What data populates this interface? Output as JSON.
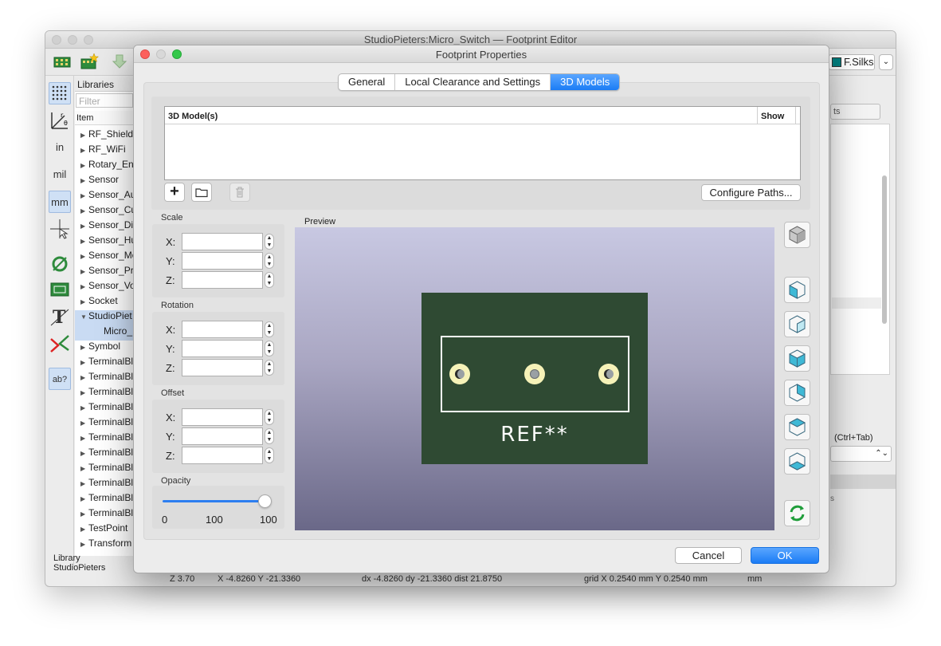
{
  "main_window": {
    "title": "StudioPieters:Micro_Switch — Footprint Editor",
    "layer_select": "F.Silks"
  },
  "left_toolbar": {
    "unit_in": "in",
    "unit_mil": "mil",
    "unit_mm": "mm",
    "ab_label": "ab?"
  },
  "libraries": {
    "header": "Libraries",
    "filter_placeholder": "Filter",
    "column_header": "Item",
    "items": [
      {
        "label": "RF_Shieldi",
        "expanded": false,
        "selected": false,
        "child": false
      },
      {
        "label": "RF_WiFi",
        "expanded": false,
        "selected": false,
        "child": false
      },
      {
        "label": "Rotary_Enc",
        "expanded": false,
        "selected": false,
        "child": false
      },
      {
        "label": "Sensor",
        "expanded": false,
        "selected": false,
        "child": false
      },
      {
        "label": "Sensor_Au",
        "expanded": false,
        "selected": false,
        "child": false
      },
      {
        "label": "Sensor_Cu",
        "expanded": false,
        "selected": false,
        "child": false
      },
      {
        "label": "Sensor_Di",
        "expanded": false,
        "selected": false,
        "child": false
      },
      {
        "label": "Sensor_Hu",
        "expanded": false,
        "selected": false,
        "child": false
      },
      {
        "label": "Sensor_Mo",
        "expanded": false,
        "selected": false,
        "child": false
      },
      {
        "label": "Sensor_Pr",
        "expanded": false,
        "selected": false,
        "child": false
      },
      {
        "label": "Sensor_Vo",
        "expanded": false,
        "selected": false,
        "child": false
      },
      {
        "label": "Socket",
        "expanded": false,
        "selected": false,
        "child": false
      },
      {
        "label": "StudioPiet",
        "expanded": true,
        "selected": true,
        "child": false
      },
      {
        "label": "Micro_",
        "expanded": false,
        "selected": true,
        "child": true
      },
      {
        "label": "Symbol",
        "expanded": false,
        "selected": false,
        "child": false
      },
      {
        "label": "TerminalBl",
        "expanded": false,
        "selected": false,
        "child": false
      },
      {
        "label": "TerminalBl",
        "expanded": false,
        "selected": false,
        "child": false
      },
      {
        "label": "TerminalBl",
        "expanded": false,
        "selected": false,
        "child": false
      },
      {
        "label": "TerminalBl",
        "expanded": false,
        "selected": false,
        "child": false
      },
      {
        "label": "TerminalBl",
        "expanded": false,
        "selected": false,
        "child": false
      },
      {
        "label": "TerminalBl",
        "expanded": false,
        "selected": false,
        "child": false
      },
      {
        "label": "TerminalBl",
        "expanded": false,
        "selected": false,
        "child": false
      },
      {
        "label": "TerminalBl",
        "expanded": false,
        "selected": false,
        "child": false
      },
      {
        "label": "TerminalBl",
        "expanded": false,
        "selected": false,
        "child": false
      },
      {
        "label": "TerminalBl",
        "expanded": false,
        "selected": false,
        "child": false
      },
      {
        "label": "TerminalBl",
        "expanded": false,
        "selected": false,
        "child": false
      },
      {
        "label": "TestPoint",
        "expanded": false,
        "selected": false,
        "child": false
      },
      {
        "label": "Transform",
        "expanded": false,
        "selected": false,
        "child": false
      }
    ],
    "footer_label": "Library",
    "footer_value": "StudioPieters"
  },
  "status_bar": {
    "zoom": "Z 3.70",
    "xy": "X -4.8260  Y -21.3360",
    "delta": "dx -4.8260  dy -21.3360  dist 21.8750",
    "grid": "grid X 0.2540 mm  Y 0.2540 mm",
    "units": "mm"
  },
  "right_panel": {
    "tab_fragment": "ts",
    "shortcut": "(Ctrl+Tab)",
    "fragment_s": "s"
  },
  "dialog": {
    "title": "Footprint Properties",
    "tabs": [
      {
        "label": "General",
        "active": false
      },
      {
        "label": "Local Clearance and Settings",
        "active": false
      },
      {
        "label": "3D Models",
        "active": true
      }
    ],
    "models_table": {
      "col_model": "3D Model(s)",
      "col_show": "Show",
      "rows": []
    },
    "add_label": "+",
    "configure_label": "Configure Paths...",
    "scale": {
      "label": "Scale",
      "x": "",
      "y": "",
      "z": ""
    },
    "rotation": {
      "label": "Rotation",
      "x": "",
      "y": "",
      "z": ""
    },
    "offset": {
      "label": "Offset",
      "x": "",
      "y": "",
      "z": ""
    },
    "axis_labels": {
      "x": "X:",
      "y": "Y:",
      "z": "Z:"
    },
    "opacity": {
      "label": "Opacity",
      "value": 100,
      "min_label": "0",
      "mid_label": "100",
      "max_label": "100"
    },
    "preview": {
      "label": "Preview",
      "ref_text": "REF**"
    },
    "cancel_label": "Cancel",
    "ok_label": "OK"
  },
  "colors": {
    "accent": "#1b7cf5",
    "pcb": "#2f4a33",
    "pad": "#f6f2b8",
    "layer_swatch": "#008080"
  }
}
